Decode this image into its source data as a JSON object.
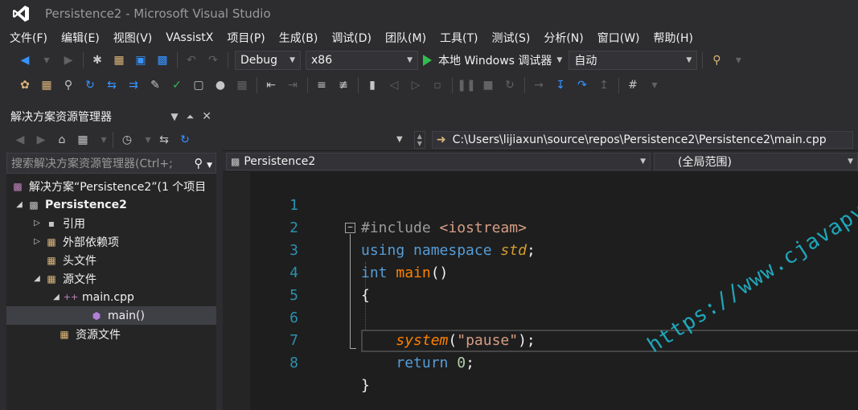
{
  "window": {
    "title": "Persistence2 - Microsoft Visual Studio"
  },
  "menu": [
    "文件(F)",
    "编辑(E)",
    "视图(V)",
    "VAssistX",
    "项目(P)",
    "生成(B)",
    "调试(D)",
    "团队(M)",
    "工具(T)",
    "测试(S)",
    "分析(N)",
    "窗口(W)",
    "帮助(H)"
  ],
  "toolbar": {
    "config": "Debug",
    "platform": "x86",
    "run_label": "本地 Windows 调试器",
    "auto": "自动"
  },
  "solution_explorer": {
    "title": "解决方案资源管理器",
    "search_placeholder": "搜索解决方案资源管理器(Ctrl+;",
    "tree": [
      {
        "label": "解决方案“Persistence2”(1 个项目",
        "bold": false
      },
      {
        "label": "Persistence2",
        "bold": true
      },
      {
        "label": "引用",
        "bold": false
      },
      {
        "label": "外部依赖项",
        "bold": false
      },
      {
        "label": "头文件",
        "bold": false
      },
      {
        "label": "源文件",
        "bold": false
      },
      {
        "label": "main.cpp",
        "bold": false
      },
      {
        "label": "main()",
        "bold": false
      },
      {
        "label": "资源文件",
        "bold": false
      }
    ]
  },
  "editor": {
    "file_path": "C:\\Users\\lijiaxun\\source\\repos\\Persistence2\\Persistence2\\main.cpp",
    "project_scope": "Persistence2",
    "scope": "(全局范围)",
    "line_numbers": [
      "1",
      "2",
      "3",
      "4",
      "5",
      "6",
      "7",
      "8"
    ],
    "lines": {
      "l1_directive": "#include",
      "l1_header": "<iostream>",
      "l2_using": "using",
      "l2_namespace": "namespace",
      "l2_std": "std",
      "l2_semi": ";",
      "l3_int": "int",
      "l3_main": "main",
      "l3_parens": "()",
      "l4_brace": "{",
      "l6_system": "system",
      "l6_open": "(",
      "l6_string": "\"pause\"",
      "l6_close": ");",
      "l7_return": "return",
      "l7_zero": "0",
      "l7_semi": ";",
      "l8_brace": "}"
    }
  },
  "watermark": "https://www.cjavapy.com"
}
